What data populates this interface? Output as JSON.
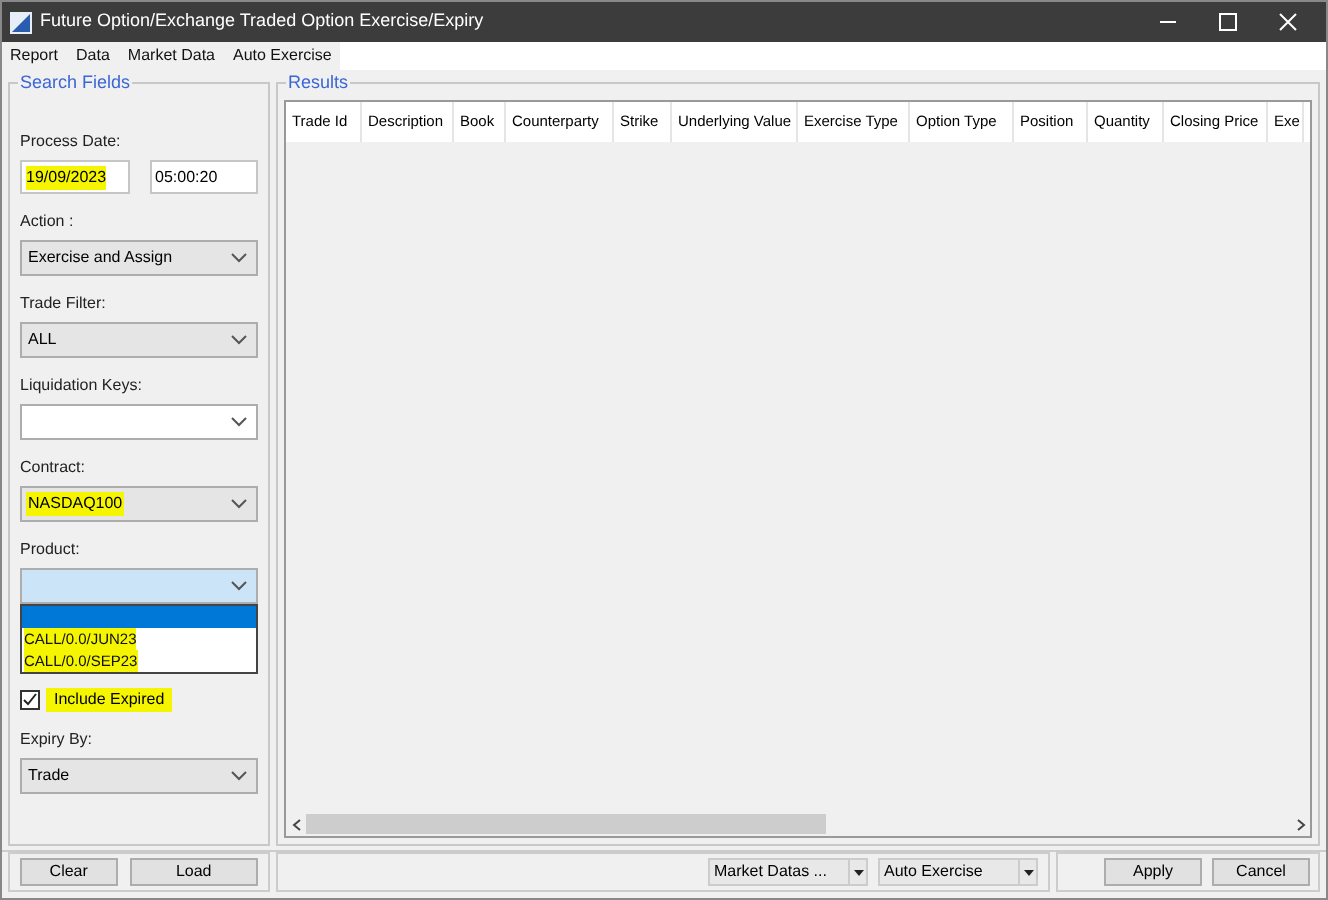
{
  "window": {
    "title": "Future Option/Exchange Traded Option Exercise/Expiry"
  },
  "menu": [
    "Report",
    "Data",
    "Market Data",
    "Auto Exercise"
  ],
  "search_fields": {
    "title": "Search Fields",
    "process_date": {
      "label": "Process Date:",
      "date": "19/09/2023",
      "time": "05:00:20",
      "highlighted": true
    },
    "action": {
      "label": "Action :",
      "value": "Exercise and Assign"
    },
    "trade_filter": {
      "label": "Trade Filter:",
      "value": "ALL"
    },
    "liquidation_keys": {
      "label": "Liquidation Keys:"
    },
    "contract": {
      "label": "Contract:",
      "value": "NASDAQ100",
      "highlighted": true
    },
    "product": {
      "label": "Product:",
      "options": [
        {
          "selected": true,
          "highlighted": false
        },
        {
          "label": "CALL/0.0/JUN23",
          "selected": false,
          "highlighted": true
        },
        {
          "label": "CALL/0.0/SEP23",
          "selected": false,
          "highlighted": true
        }
      ]
    },
    "include_expired": {
      "label": "Include Expired",
      "checked": true,
      "highlighted": true
    },
    "expiry_by": {
      "label": "Expiry By:",
      "value": "Trade"
    }
  },
  "results": {
    "title": "Results",
    "columns": [
      "Trade Id",
      "Description",
      "Book",
      "Counterparty",
      "Strike",
      "Underlying Value",
      "Exercise Type",
      "Option Type",
      "Position",
      "Quantity",
      "Closing Price",
      "Exe"
    ]
  },
  "left_buttons": [
    "Clear",
    "Load"
  ],
  "dropdowns": [
    "Market Datas ...",
    "Auto Exercise"
  ],
  "right_buttons": [
    "Apply",
    "Cancel"
  ]
}
